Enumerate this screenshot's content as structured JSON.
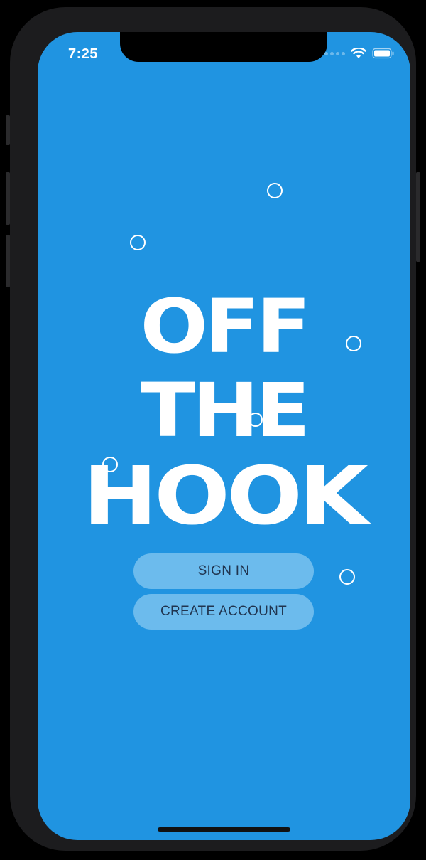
{
  "status_bar": {
    "time": "7:25",
    "icons": [
      "signal-dots-icon",
      "wifi-icon",
      "battery-icon"
    ]
  },
  "logo": {
    "line1": "OFF",
    "line2": "THE",
    "line3": "HOOK"
  },
  "buttons": {
    "sign_in": "SIGN IN",
    "create_account": "CREATE ACCOUNT"
  },
  "colors": {
    "background": "#2094e1",
    "button_bg": "#6cbbed",
    "button_text": "#20344f",
    "logo_text": "#ffffff",
    "device_frame": "#1c1c1e"
  }
}
